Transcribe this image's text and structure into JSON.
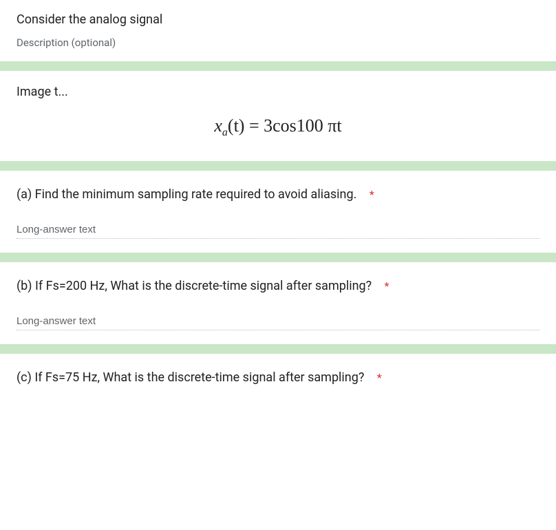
{
  "header": {
    "title": "Consider the analog signal",
    "description_placeholder": "Description (optional)"
  },
  "image": {
    "label": "Image t...",
    "equation_prefix": "x",
    "equation_subscript": "a",
    "equation_middle": "(t) = 3cos100 πt"
  },
  "questions": [
    {
      "text": "(a) Find the minimum sampling rate required to avoid aliasing.",
      "required": "*",
      "placeholder": "Long-answer text"
    },
    {
      "text": "(b) If Fs=200 Hz, What is the discrete-time signal after sampling?",
      "required": "*",
      "placeholder": "Long-answer text"
    },
    {
      "text": "(c) If Fs=75 Hz, What is the discrete-time signal after sampling?",
      "required": "*",
      "placeholder": ""
    }
  ]
}
